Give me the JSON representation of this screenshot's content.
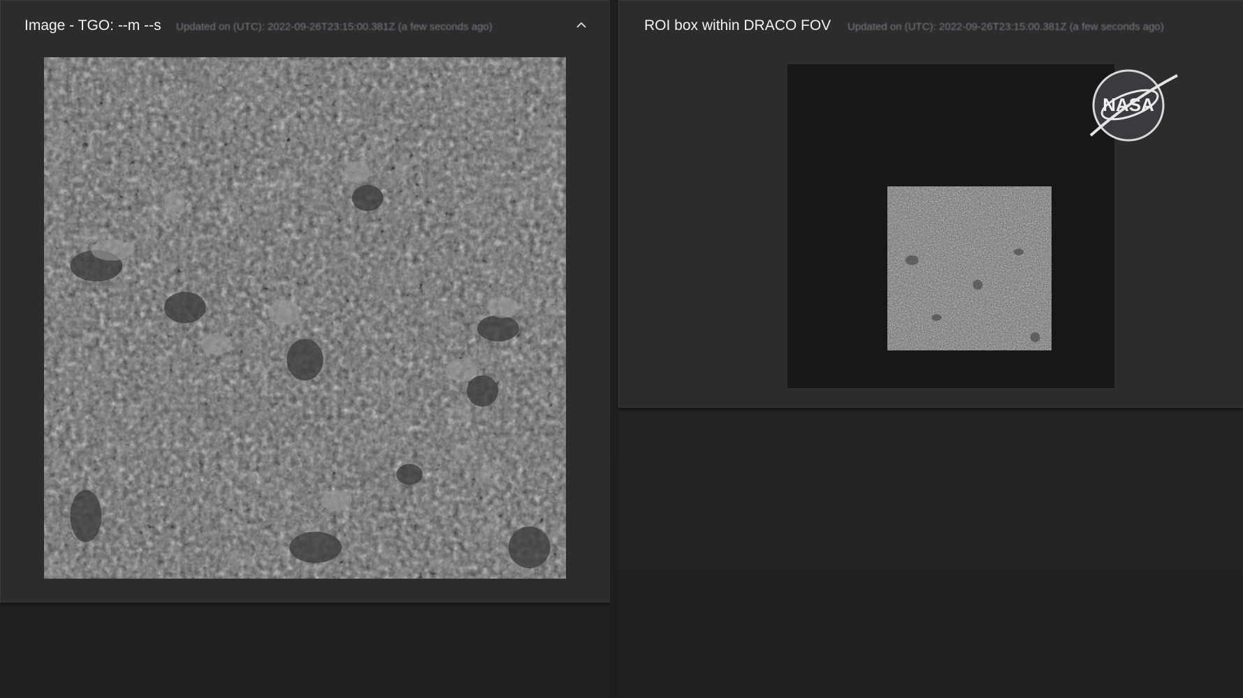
{
  "left_panel": {
    "title": "Image - TGO: --m --s",
    "updated": "Updated on (UTC): 2022-09-26T23:15:00.381Z (a few seconds ago)",
    "collapse_icon": "chevron-up-icon"
  },
  "right_panel": {
    "title": "ROI box within DRACO FOV",
    "updated": "Updated on (UTC): 2022-09-26T23:15:00.381Z (a few seconds ago)",
    "logo": "NASA"
  },
  "colors": {
    "page_bg": "#232325",
    "panel_bg": "#2b2c2e",
    "title_text": "#f2f2f2",
    "muted_text": "#7a7b7e"
  }
}
